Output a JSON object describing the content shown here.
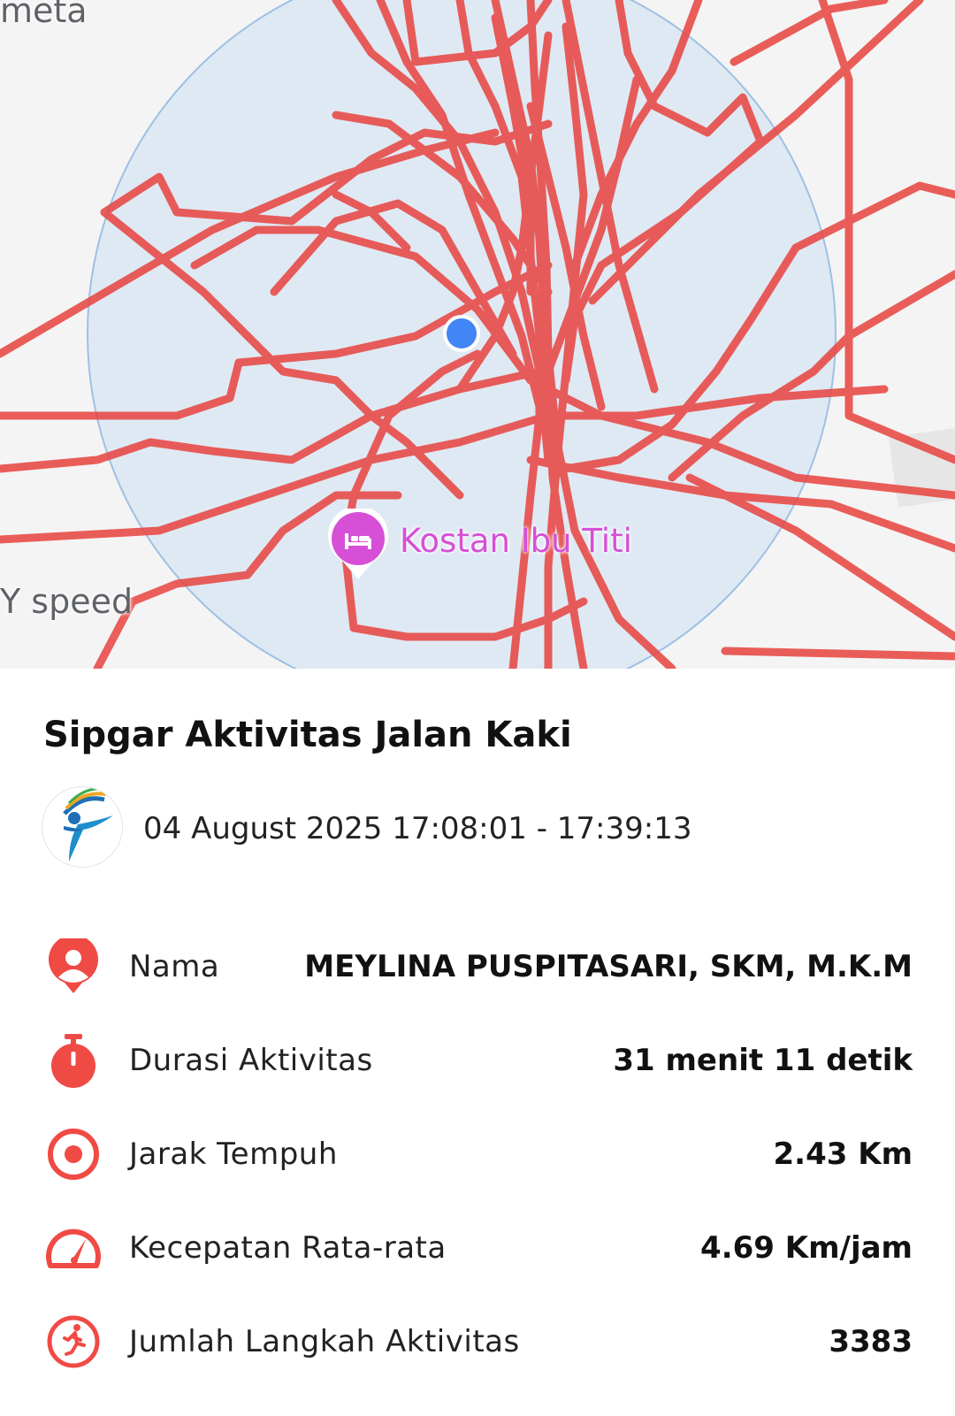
{
  "map": {
    "label_top_left": "meta",
    "label_left": "Y speed",
    "poi": {
      "label": "Kostan Ibu Titi",
      "icon": "bed-icon"
    },
    "colors": {
      "route": "#e8433f",
      "accuracy_fill": "#dfe9f3",
      "location_dot": "#4285f4",
      "poi": "#d64fd6"
    }
  },
  "activity": {
    "title": "Sipgar Aktivitas Jalan Kaki",
    "datetime": "04 August 2025 17:08:01 - 17:39:13"
  },
  "stats": [
    {
      "icon": "person-pin-icon",
      "label": "Nama",
      "value": "MEYLINA PUSPITASARI, SKM, M.K.M"
    },
    {
      "icon": "stopwatch-icon",
      "label": "Durasi Aktivitas",
      "value": "31 menit 11 detik"
    },
    {
      "icon": "target-icon",
      "label": "Jarak Tempuh",
      "value": "2.43 Km"
    },
    {
      "icon": "speedometer-icon",
      "label": "Kecepatan Rata-rata",
      "value": "4.69 Km/jam"
    },
    {
      "icon": "running-icon",
      "label": "Jumlah Langkah Aktivitas",
      "value": "3383"
    }
  ],
  "accent_color": "#f04a45"
}
